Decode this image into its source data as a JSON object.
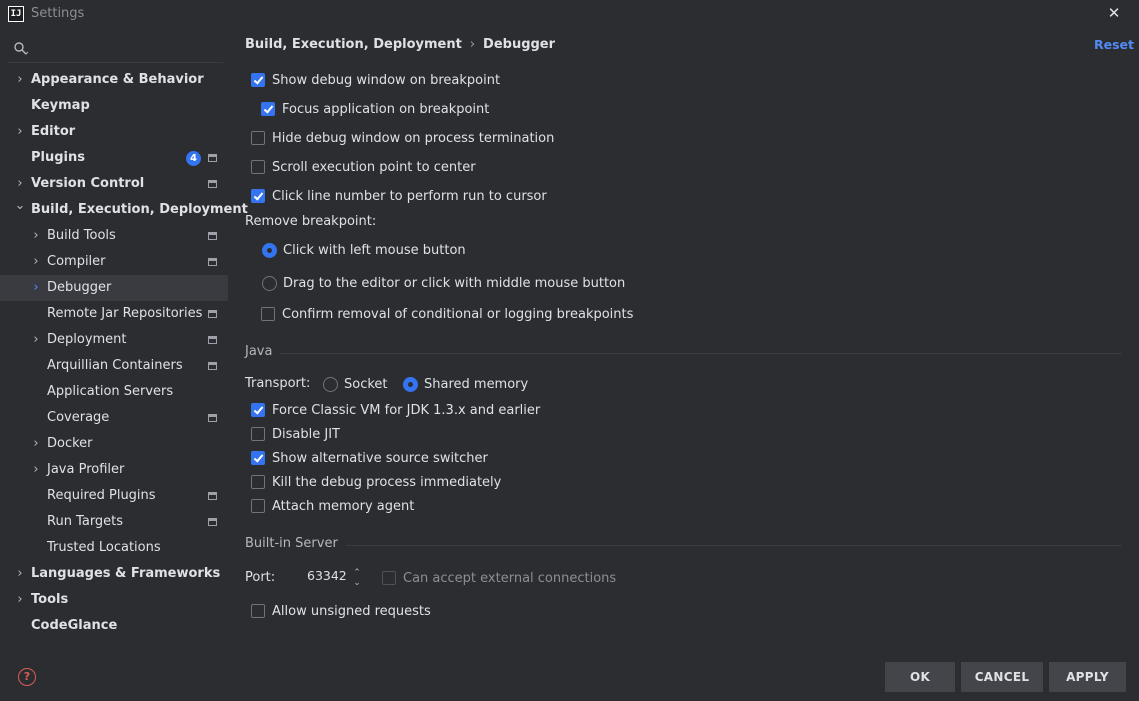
{
  "window": {
    "title": "Settings",
    "app_icon_text": "IJ"
  },
  "search": {
    "placeholder": "",
    "value": ""
  },
  "sidebar": {
    "items": [
      {
        "label": "Appearance & Behavior",
        "bold": true,
        "level": 0,
        "expander": "right"
      },
      {
        "label": "Keymap",
        "bold": true,
        "level": 0
      },
      {
        "label": "Editor",
        "bold": true,
        "level": 0,
        "expander": "right"
      },
      {
        "label": "Plugins",
        "bold": true,
        "level": 0,
        "badge": "4",
        "project_icon": true
      },
      {
        "label": "Version Control",
        "bold": true,
        "level": 0,
        "expander": "right",
        "project_icon": true
      },
      {
        "label": "Build, Execution, Deployment",
        "bold": true,
        "level": 0,
        "expander": "down"
      },
      {
        "label": "Build Tools",
        "level": 1,
        "expander": "right",
        "project_icon": true
      },
      {
        "label": "Compiler",
        "level": 1,
        "expander": "right",
        "project_icon": true
      },
      {
        "label": "Debugger",
        "level": 1,
        "expander": "right",
        "selected": true
      },
      {
        "label": "Remote Jar Repositories",
        "level": 1,
        "project_icon": true
      },
      {
        "label": "Deployment",
        "level": 1,
        "expander": "right",
        "project_icon": true
      },
      {
        "label": "Arquillian Containers",
        "level": 1,
        "project_icon": true
      },
      {
        "label": "Application Servers",
        "level": 1
      },
      {
        "label": "Coverage",
        "level": 1,
        "project_icon": true
      },
      {
        "label": "Docker",
        "level": 1,
        "expander": "right"
      },
      {
        "label": "Java Profiler",
        "level": 1,
        "expander": "right"
      },
      {
        "label": "Required Plugins",
        "level": 1,
        "project_icon": true
      },
      {
        "label": "Run Targets",
        "level": 1,
        "project_icon": true
      },
      {
        "label": "Trusted Locations",
        "level": 1
      },
      {
        "label": "Languages & Frameworks",
        "bold": true,
        "level": 0,
        "expander": "right"
      },
      {
        "label": "Tools",
        "bold": true,
        "level": 0,
        "expander": "right"
      },
      {
        "label": "CodeGlance",
        "bold": true,
        "level": 0
      }
    ]
  },
  "header": {
    "breadcrumb": [
      "Build, Execution, Deployment",
      "Debugger"
    ],
    "breadcrumb_separator": "›",
    "reset_label": "Reset"
  },
  "general": {
    "show_debug_window": {
      "label": "Show debug window on breakpoint",
      "checked": true
    },
    "focus_application": {
      "label": "Focus application on breakpoint",
      "checked": true
    },
    "hide_debug_window": {
      "label": "Hide debug window on process termination",
      "checked": false
    },
    "scroll_execution_point": {
      "label": "Scroll execution point to center",
      "checked": false
    },
    "click_line_number": {
      "label": "Click line number to perform run to cursor",
      "checked": true
    },
    "remove_breakpoint_label": "Remove breakpoint:",
    "remove_left_click": {
      "label": "Click with left mouse button",
      "checked": true
    },
    "remove_drag_middle": {
      "label": "Drag to the editor or click with middle mouse button",
      "checked": false
    },
    "confirm_removal": {
      "label": "Confirm removal of conditional or logging breakpoints",
      "checked": false
    }
  },
  "java": {
    "section_title": "Java",
    "transport_label": "Transport:",
    "socket": {
      "label": "Socket",
      "checked": false
    },
    "shared_memory": {
      "label": "Shared memory",
      "checked": true
    },
    "force_classic_vm": {
      "label": "Force Classic VM for JDK 1.3.x and earlier",
      "checked": true
    },
    "disable_jit": {
      "label": "Disable JIT",
      "checked": false
    },
    "show_alt_source": {
      "label": "Show alternative source switcher",
      "checked": true
    },
    "kill_immediately": {
      "label": "Kill the debug process immediately",
      "checked": false
    },
    "attach_memory_agent": {
      "label": "Attach memory agent",
      "checked": false
    }
  },
  "builtin_server": {
    "section_title": "Built-in Server",
    "port_label": "Port:",
    "port_value": "63342",
    "accept_external": {
      "label": "Can accept external connections",
      "checked": false,
      "disabled": true
    },
    "allow_unsigned": {
      "label": "Allow unsigned requests",
      "checked": false
    }
  },
  "footer": {
    "ok_label": "OK",
    "cancel_label": "CANCEL",
    "apply_label": "APPLY",
    "help_glyph": "?"
  },
  "colors": {
    "background": "#2b2d30",
    "accent": "#3574f0",
    "link": "#548af7",
    "help": "#db5c5c",
    "button": "#43454a",
    "selection": "#393b40"
  }
}
